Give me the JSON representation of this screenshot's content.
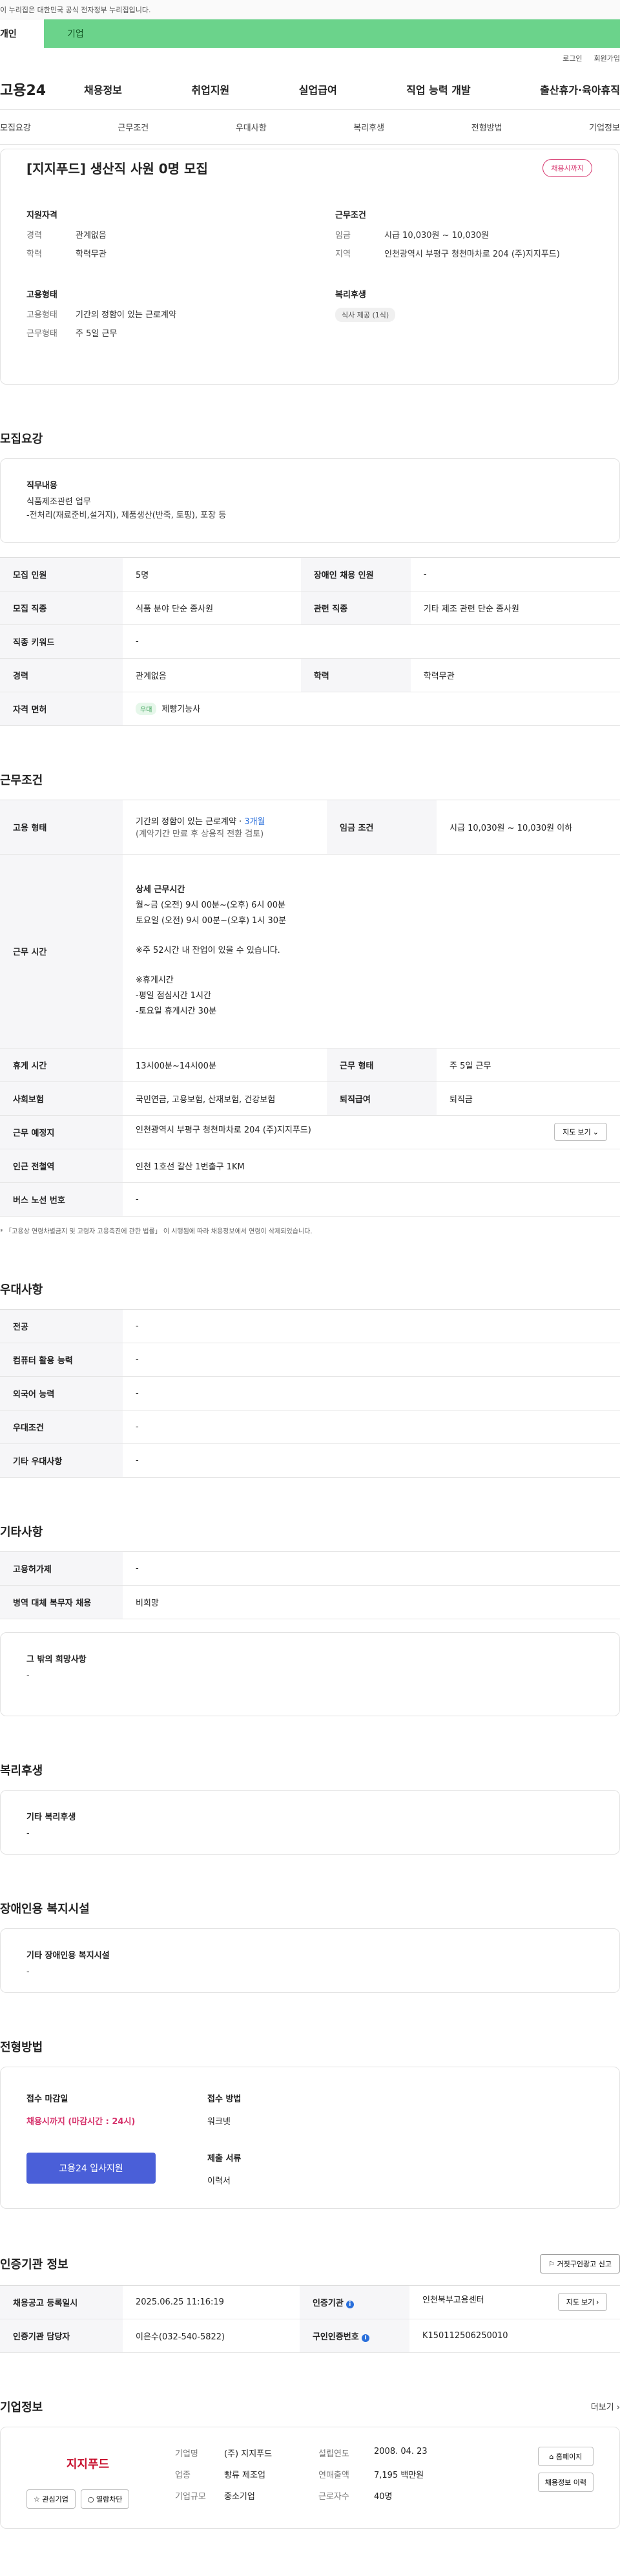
{
  "gov_banner": "이 누리집은 대한민국 공식 전자정부 누리집입니다.",
  "top_tabs": {
    "personal": "개인",
    "company": "기업"
  },
  "util": {
    "login": "로그인",
    "signup": "회원가입"
  },
  "gnb": {
    "logo": "고용24",
    "menu": [
      "채용정보",
      "취업지원",
      "실업급여",
      "직업 능력 개발",
      "출산휴가·육아휴직"
    ]
  },
  "subnav": [
    "모집요강",
    "근무조건",
    "우대사항",
    "복리후생",
    "전형방법",
    "기업정보"
  ],
  "summary": {
    "title": "[지지푸드] 생산직 사원 0명 모집",
    "badge": "채용시까지",
    "qualification": {
      "heading": "지원자격",
      "rows": [
        {
          "k": "경력",
          "v": "관계없음"
        },
        {
          "k": "학력",
          "v": "학력무관"
        }
      ]
    },
    "conditions": {
      "heading": "근무조건",
      "rows": [
        {
          "k": "임금",
          "v": "시급 10,030원 ~ 10,030원"
        },
        {
          "k": "지역",
          "v": "인천광역시 부평구 청천마차로 204 (주)지지푸드)"
        }
      ]
    },
    "employment": {
      "heading": "고용형태",
      "rows": [
        {
          "k": "고용형태",
          "v": "기간의 정함이 있는 근로계약"
        },
        {
          "k": "근무형태",
          "v": "주 5일 근무"
        }
      ]
    },
    "welfare": {
      "heading": "복리후생",
      "chip": "식사 제공 (1식)"
    }
  },
  "recruit": {
    "title": "모집요강",
    "job_desc_heading": "직무내용",
    "job_desc_lines": [
      "식품제조관련 업무",
      "-전처리(재료준비,설거지), 제품생산(반죽, 토핑), 포장 등"
    ],
    "rows": [
      {
        "k1": "모집 인원",
        "v1": "5명",
        "k2": "장애인 채용 인원",
        "v2": "-"
      },
      {
        "k1": "모집 직종",
        "v1": "식품 분야 단순 종사원",
        "k2": "관련 직종",
        "v2": "기타 제조 관련 단순 종사원"
      },
      {
        "k1": "직종 키워드",
        "v1": "-",
        "k2": "",
        "v2": ""
      },
      {
        "k1": "경력",
        "v1": "관계없음",
        "k2": "학력",
        "v2": "학력무관"
      }
    ],
    "license_label": "자격 면허",
    "license_badge": "우대",
    "license_value": "제빵기능사"
  },
  "work": {
    "title": "근무조건",
    "emp_type_label": "고용 형태",
    "emp_type_value": "기간의 정함이 있는 근로계약 · ",
    "emp_type_months": "3개월",
    "emp_type_note": "(계약기간 만료 후 상용직 전환 검토)",
    "wage_label": "임금 조건",
    "wage_value": "시급 10,030원 ~ 10,030원 이하",
    "hours_label": "근무 시간",
    "hours_lines": [
      "상세 근무시간",
      "월~금 (오전) 9시 00분~(오후) 6시 00분",
      "토요일 (오전) 9시 00분~(오후) 1시 30분",
      "",
      "※주 52시간 내 잔업이 있을 수 있습니다.",
      "",
      "※휴게시간",
      "-평일 점심시간 1시간",
      "-토요일 휴게시간 30분"
    ],
    "break_label": "휴게 시간",
    "break_value": "13시00분~14시00분",
    "shift_label": "근무 형태",
    "shift_value": "주 5일 근무",
    "insurance_label": "사회보험",
    "insurance_value": "국민연금, 고용보험, 산재보험, 건강보험",
    "severance_label": "퇴직급여",
    "severance_value": "퇴직금",
    "location_label": "근무 예정지",
    "location_value": "인천광역시 부평구 청천마차로 204 (주)지지푸드)",
    "map_button": "지도 보기",
    "subway_label": "인근 전철역",
    "subway_value": "인천 1호선 갈산 1번출구 1KM",
    "bus_label": "버스 노선 번호",
    "bus_value": "-",
    "note": "* 「고용상 연령차별금지 및 고령자 고용촉진에 관한 법률」 이 시행됨에 따라 채용정보에서 연령이 삭제되었습니다."
  },
  "preference": {
    "title": "우대사항",
    "rows": [
      {
        "k": "전공",
        "v": "-"
      },
      {
        "k": "컴퓨터 활용 능력",
        "v": "-"
      },
      {
        "k": "외국어 능력",
        "v": "-"
      },
      {
        "k": "우대조건",
        "v": "-"
      },
      {
        "k": "기타 우대사항",
        "v": "-"
      }
    ]
  },
  "etc": {
    "title": "기타사항",
    "rows": [
      {
        "k": "고용허가제",
        "v": "-"
      },
      {
        "k": "병역 대체 복무자 채용",
        "v": "비희망"
      }
    ],
    "other_heading": "그 밖의 희망사항",
    "other_value": "-"
  },
  "benefits": {
    "title": "복리후생",
    "heading": "기타 복리후생",
    "value": "-"
  },
  "disability": {
    "title": "장애인용 복지시설",
    "heading": "기타 장애인용 복지시설",
    "value": "-"
  },
  "selection": {
    "title": "전형방법",
    "deadline_heading": "접수 마감일",
    "deadline_value": "채용시까지 (마감시간 : 24시)",
    "apply_button": "고용24 입사지원",
    "method_heading": "접수 방법",
    "method_value": "워크넷",
    "docs_heading": "제출 서류",
    "docs_value": "이력서"
  },
  "cert": {
    "title": "인증기관 정보",
    "report_button": "거짓구인광고 신고",
    "rows": [
      {
        "k1": "채용공고 등록일시",
        "v1": "2025.06.25 11:16:19",
        "k2": "인증기관",
        "v2": "인천북부고용센터"
      },
      {
        "k1": "인증기관 담당자",
        "v1": "이은수(032-540-5822)",
        "k2": "구인인증번호",
        "v2": "K150112506250010"
      }
    ],
    "map_button": "지도 보기"
  },
  "company": {
    "title": "기업정보",
    "more": "더보기",
    "logo_text": "지지푸드",
    "fav_button": "관심기업",
    "block_button": "열람차단",
    "info": [
      {
        "k": "기업명",
        "v": "(주) 지지푸드",
        "k2": "설립연도",
        "v2": "2008. 04. 23"
      },
      {
        "k": "업종",
        "v": "빵류 제조업",
        "k2": "연매출액",
        "v2": "7,195 백만원"
      },
      {
        "k": "기업규모",
        "v": "중소기업",
        "k2": "근로자수",
        "v2": "40명"
      }
    ],
    "homepage_button": "홈페이지",
    "history_button": "채용정보 이력"
  }
}
